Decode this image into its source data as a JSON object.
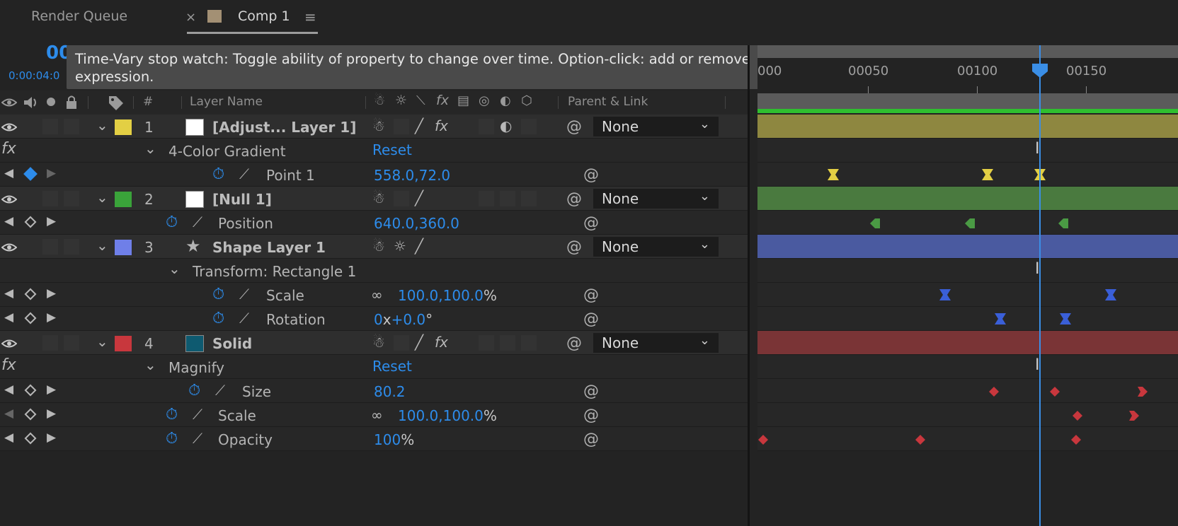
{
  "tabs": {
    "render_queue": "Render Queue",
    "close": "×",
    "comp": "Comp 1",
    "menu": "≡"
  },
  "timecode": {
    "big": "00",
    "small": "0:00:04:0"
  },
  "tooltip": "Time-Vary stop watch: Toggle ability of property to change over time. Option-click: add or remove expression.",
  "columns": {
    "num": "#",
    "layer_name": "Layer Name",
    "fx": "fx",
    "parent": "Parent & Link"
  },
  "ruler": {
    "labels": [
      "000",
      "00050",
      "00100",
      "00150"
    ]
  },
  "layers": [
    {
      "num": "1",
      "name": "[Adjust... Layer 1]",
      "parent": "None",
      "label_color": "#e3cf44",
      "src_color": "#ffffff",
      "bar_color": "#8e8740"
    },
    {
      "num": "2",
      "name": "[Null 1]",
      "parent": "None",
      "label_color": "#3aa33a",
      "src_color": "#ffffff",
      "bar_color": "#4a7a3f"
    },
    {
      "num": "3",
      "name": "Shape Layer 1",
      "parent": "None",
      "label_color": "#6f7fe8",
      "bar_color": "#4a5aa0"
    },
    {
      "num": "4",
      "name": "Solid",
      "parent": "None",
      "label_color": "#c8373d",
      "src_color": "#0e5a70",
      "bar_color": "#7a3436"
    }
  ],
  "props": {
    "effect1": {
      "fx": "fx",
      "name": "4-Color Gradient",
      "reset": "Reset"
    },
    "point1": {
      "name": "Point 1",
      "value": "558.0,72.0"
    },
    "position": {
      "name": "Position",
      "value": "640.0,360.0"
    },
    "transform": {
      "name": "Transform: Rectangle 1"
    },
    "scale3": {
      "name": "Scale",
      "value": "100.0,100.0",
      "unit": "%"
    },
    "rotation": {
      "name": "Rotation",
      "value_a": "0",
      "value_x": "x",
      "value_b": "+0.0",
      "unit": "°"
    },
    "effect4": {
      "fx": "fx",
      "name": "Magnify",
      "reset": "Reset"
    },
    "size": {
      "name": "Size",
      "value": "80.2"
    },
    "scale4": {
      "name": "Scale",
      "value": "100.0,100.0",
      "unit": "%"
    },
    "opacity": {
      "name": "Opacity",
      "value": "100",
      "unit": "%"
    }
  },
  "colors": {
    "accent": "#2d8ceb",
    "cti": "#3a8ee6",
    "work_area_bar": "#2fbf2f"
  }
}
